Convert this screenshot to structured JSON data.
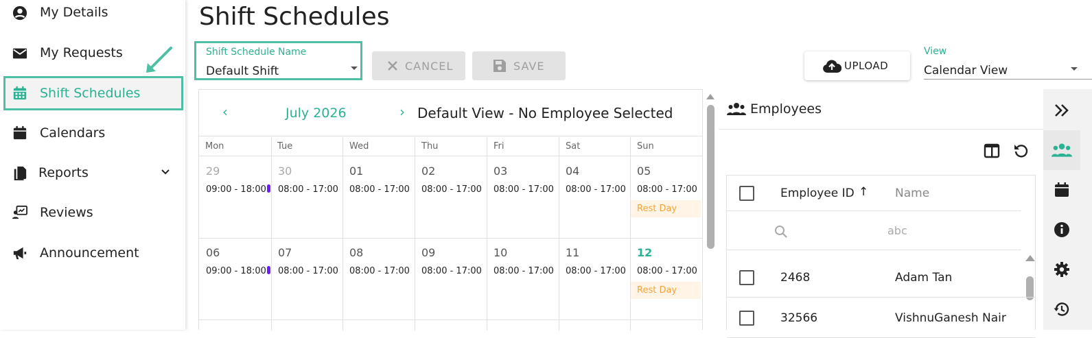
{
  "sidebar": {
    "items": [
      {
        "label": "My Details",
        "icon": "account-circle-icon"
      },
      {
        "label": "My Requests",
        "icon": "mail-icon"
      },
      {
        "label": "Shift Schedules",
        "icon": "calendar-grid-icon",
        "active": true
      },
      {
        "label": "Calendars",
        "icon": "calendar-icon"
      },
      {
        "label": "Reports",
        "icon": "files-icon",
        "expandable": true
      },
      {
        "label": "Reviews",
        "icon": "review-icon"
      },
      {
        "label": "Announcement",
        "icon": "megaphone-icon"
      }
    ]
  },
  "header": {
    "title": "Shift Schedules"
  },
  "toolbar": {
    "schedule_label": "Shift Schedule Name",
    "schedule_value": "Default Shift",
    "cancel_label": "CANCEL",
    "save_label": "SAVE",
    "upload_label": "UPLOAD",
    "view_label": "View",
    "view_value": "Calendar View"
  },
  "calendar": {
    "month": "July 2026",
    "prev": "‹",
    "next": "›",
    "view_name": "Default View - No Employee Selected",
    "weekdays": [
      "Mon",
      "Tue",
      "Wed",
      "Thu",
      "Fri",
      "Sat",
      "Sun"
    ],
    "weeks": [
      [
        {
          "day": "29",
          "shift": "09:00 - 18:00",
          "faded": true,
          "marker": true
        },
        {
          "day": "30",
          "shift": "08:00 - 17:00",
          "faded": true
        },
        {
          "day": "01",
          "shift": "08:00 - 17:00"
        },
        {
          "day": "02",
          "shift": "08:00 - 17:00"
        },
        {
          "day": "03",
          "shift": "08:00 - 17:00"
        },
        {
          "day": "04",
          "shift": "08:00 - 17:00"
        },
        {
          "day": "05",
          "shift": "08:00 - 17:00",
          "tag": "Rest Day"
        }
      ],
      [
        {
          "day": "06",
          "shift": "09:00 - 18:00",
          "marker": true
        },
        {
          "day": "07",
          "shift": "08:00 - 17:00"
        },
        {
          "day": "08",
          "shift": "08:00 - 17:00"
        },
        {
          "day": "09",
          "shift": "08:00 - 17:00"
        },
        {
          "day": "10",
          "shift": "08:00 - 17:00"
        },
        {
          "day": "11",
          "shift": "08:00 - 17:00"
        },
        {
          "day": "12",
          "shift": "08:00 - 17:00",
          "tag": "Rest Day",
          "today": true
        }
      ]
    ]
  },
  "employees": {
    "title": "Employees",
    "columns": {
      "id": "Employee ID",
      "sort": "↑",
      "name": "Name"
    },
    "filter_placeholder": "abc",
    "rows": [
      {
        "id": "2468",
        "name": "Adam Tan"
      },
      {
        "id": "32566",
        "name": "VishnuGanesh Nair"
      }
    ]
  },
  "rail": {
    "items": [
      "double-chevron-right-icon",
      "people-icon",
      "calendar-icon",
      "info-icon",
      "gear-icon",
      "history-icon"
    ]
  },
  "colors": {
    "accent": "#2bb193",
    "accent_border": "#4dbfa5",
    "rest_day_bg": "#fff4e6",
    "rest_day_text": "#f5a339",
    "marker": "#6a1bff"
  }
}
